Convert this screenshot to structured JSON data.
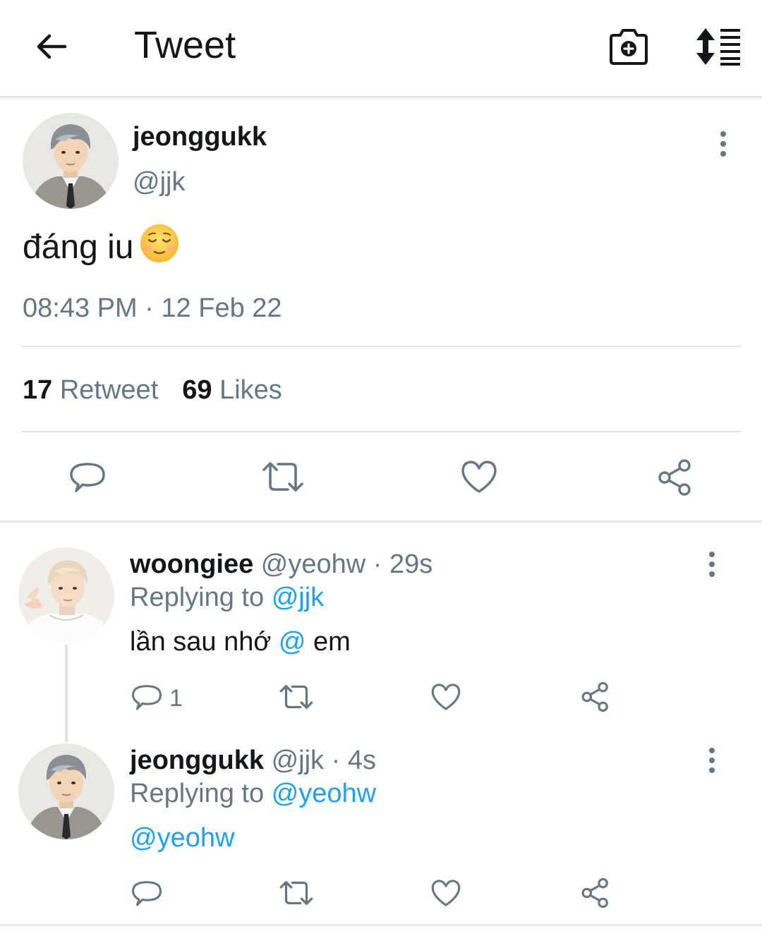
{
  "header": {
    "title": "Tweet"
  },
  "tweet": {
    "author_name": "jeonggukk",
    "author_handle": "@jjk",
    "text": "đáng iu",
    "emoji": "relieved-face-emoji",
    "time": "08:43 PM · 12 Feb 22",
    "retweet_count": "17",
    "retweet_label": "Retweet",
    "like_count": "69",
    "like_label": "Likes"
  },
  "replies": [
    {
      "author_name": "woongiee",
      "author_handle": "@yeohw",
      "time": "· 29s",
      "replying_label": "Replying to",
      "replying_to": "@jjk",
      "text_before": "lần sau nhớ",
      "text_mention": "@",
      "text_after": "em",
      "reply_count": "1"
    },
    {
      "author_name": "jeonggukk",
      "author_handle": "@jjk",
      "time": "· 4s",
      "replying_label": "Replying to",
      "replying_to": "@yeohw",
      "text_mention": "@yeohw"
    }
  ],
  "colors": {
    "accent": "#1da1f2",
    "secondary_text": "#657786",
    "primary_text": "#14171a",
    "icon": "#657786"
  }
}
